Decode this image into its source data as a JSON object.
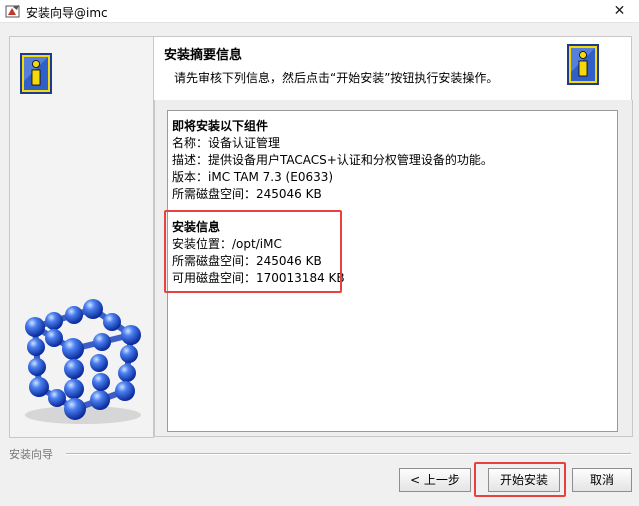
{
  "window": {
    "title": "安装向导@imc",
    "close_glyph": "✕"
  },
  "header": {
    "title": "安装摘要信息",
    "description": "请先审核下列信息，然后点击“开始安装”按钮执行安装操作。"
  },
  "summary": {
    "components_heading": "即将安装以下组件",
    "name": "名称：设备认证管理",
    "desc": "描述：提供设备用户TACACS+认证和分权管理设备的功能。",
    "version": "版本：iMC TAM 7.3 (E0633)",
    "disk_required": "所需磁盘空间：245046 KB",
    "install_heading": "安装信息",
    "install_location": "安装位置：/opt/iMC",
    "install_disk_required": "所需磁盘空间：245046 KB",
    "available_disk": "可用磁盘空间：170013184 KB"
  },
  "footer": {
    "label": "安装向导",
    "back_button": "< 上一步",
    "install_button": "开始安装",
    "cancel_button": "取消"
  },
  "colors": {
    "highlight": "#e8423f",
    "info_yellow": "#f5d90a",
    "info_blue": "#2f5fc7"
  }
}
